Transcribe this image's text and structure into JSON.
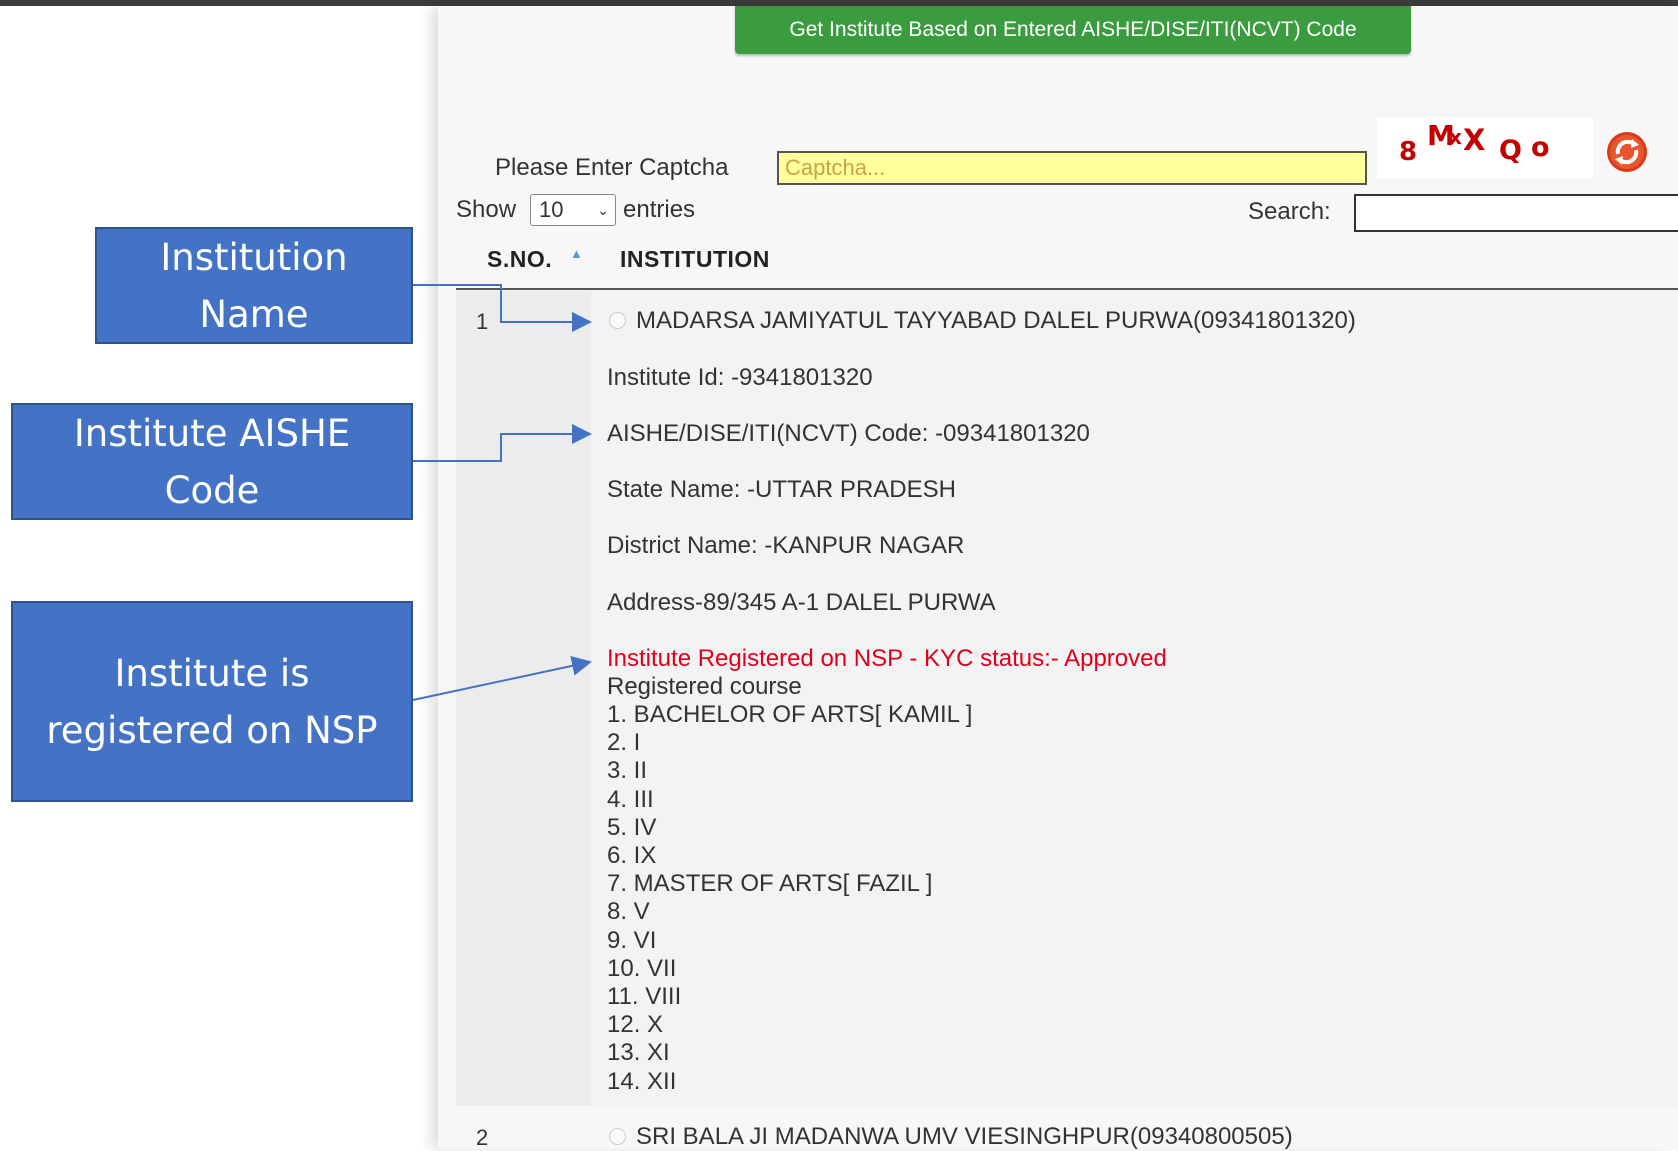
{
  "top_button": {
    "label": "Get Institute Based on Entered AISHE/DISE/ITI(NCVT) Code"
  },
  "captcha": {
    "label": "Please Enter Captcha",
    "placeholder": "Captcha...",
    "image_text": [
      "8",
      "M",
      "x",
      "X",
      "Q",
      "o"
    ],
    "refresh_icon": "refresh-icon"
  },
  "table_controls": {
    "show_label": "Show",
    "entries_value": "10",
    "entries_label": "entries",
    "search_label": "Search:",
    "search_value": ""
  },
  "table": {
    "columns": [
      "S.NO.",
      "INSTITUTION"
    ],
    "rows": [
      {
        "sno": "1",
        "institution": "MADARSA JAMIYATUL TAYYABAD DALEL PURWA(09341801320)",
        "institute_id": "Institute Id: -9341801320",
        "aishe_code": "AISHE/DISE/ITI(NCVT) Code: -09341801320",
        "state": "State Name: -UTTAR PRADESH",
        "district": "District Name: -KANPUR NAGAR",
        "address": "Address-89/345 A-1 DALEL PURWA",
        "status": "Institute Registered on NSP - KYC status:- Approved",
        "registered_course_label": "Registered course",
        "courses": [
          "1. BACHELOR OF ARTS[ KAMIL ]",
          "2. I",
          "3. II",
          "4. III",
          "5. IV",
          "6. IX",
          "7. MASTER OF ARTS[ FAZIL ]",
          "8. V",
          "9. VI",
          "10. VII",
          "11. VIII",
          "12. X",
          "13. XI",
          "14. XII"
        ]
      },
      {
        "sno": "2",
        "institution": "SRI BALA JI MADANWA UMV VIESINGHPUR(09340800505)"
      }
    ]
  },
  "callouts": [
    {
      "text": "Institution Name"
    },
    {
      "text": "Institute AISHE Code"
    },
    {
      "text": "Institute is registered on NSP"
    }
  ],
  "colors": {
    "button_green": "#3a9b3f",
    "callout_blue": "#4472c4",
    "status_red": "#e0001b",
    "captcha_bg": "#ffff9c"
  }
}
